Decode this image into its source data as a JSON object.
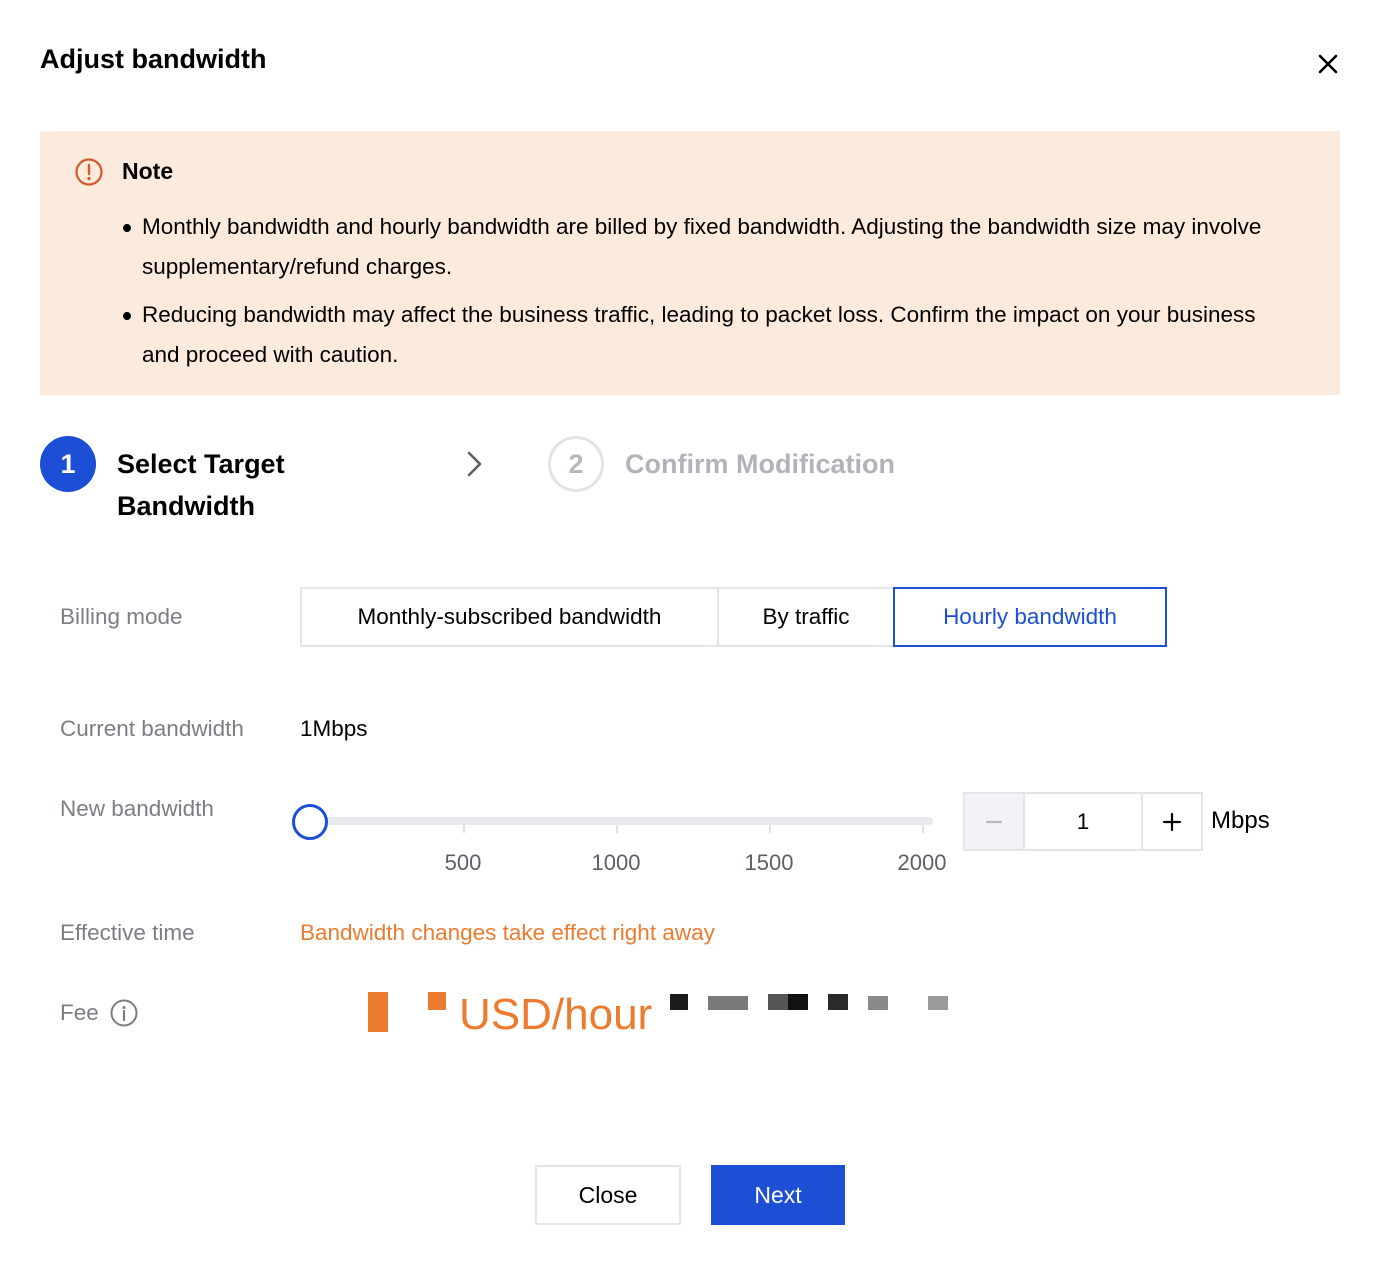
{
  "dialog": {
    "title": "Adjust bandwidth"
  },
  "note": {
    "title": "Note",
    "items": [
      "Monthly bandwidth and hourly bandwidth are billed by fixed bandwidth. Adjusting the bandwidth size may involve supplementary/refund charges.",
      "Reducing bandwidth may affect the business traffic, leading to packet loss. Confirm the impact on your business and proceed with caution."
    ]
  },
  "steps": [
    {
      "number": "1",
      "label": "Select Target Bandwidth",
      "state": "active"
    },
    {
      "number": "2",
      "label": "Confirm Modification",
      "state": "pending"
    }
  ],
  "form": {
    "billing_mode": {
      "label": "Billing mode",
      "options": [
        "Monthly-subscribed bandwidth",
        "By traffic",
        "Hourly bandwidth"
      ],
      "selected": "Hourly bandwidth"
    },
    "current_bandwidth": {
      "label": "Current bandwidth",
      "value": "1Mbps"
    },
    "new_bandwidth": {
      "label": "New bandwidth",
      "slider": {
        "min": 1,
        "max": 2000,
        "value": 1,
        "tick_labels": [
          "500",
          "1000",
          "1500",
          "2000"
        ]
      },
      "stepper_value": "1",
      "unit": "Mbps"
    },
    "effective_time": {
      "label": "Effective time",
      "value": "Bandwidth changes take effect right away"
    },
    "fee": {
      "label": "Fee",
      "unit": "USD/hour"
    }
  },
  "footer": {
    "close_label": "Close",
    "next_label": "Next"
  },
  "colors": {
    "primary": "#1c4fd6",
    "warning": "#ed7b2f",
    "note_bg": "#fcebdd"
  },
  "icons": {
    "close": "close-icon",
    "note": "exclamation-circle-icon",
    "step_separator": "chevron-right-icon",
    "fee_info": "info-circle-icon",
    "minus": "minus-icon",
    "plus": "plus-icon"
  }
}
